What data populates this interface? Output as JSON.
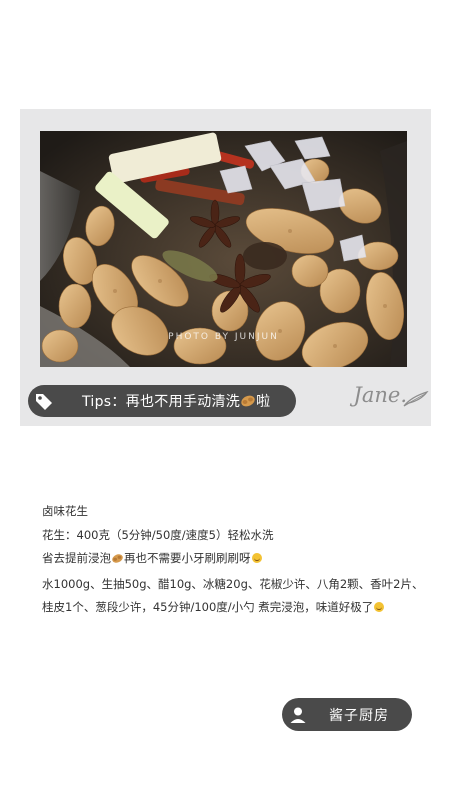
{
  "card": {
    "photo": {
      "alt": "Peanuts with star anise, cinnamon, chili, scallion and rock sugar in a pot",
      "watermark": "PHOTO BY JUNJUN"
    },
    "tips": {
      "icon": "tag-icon",
      "text_before": "Tips：再也不用手动清洗",
      "emoji": "peanut-emoji",
      "text_after": "啦"
    },
    "signature": "Jane.",
    "signature_icon": "feather-icon"
  },
  "recipe": {
    "title": "卤味花生",
    "line1": "花生：400克（5分钟/50度/速度5）轻松水洗",
    "line2_before": "省去提前浸泡",
    "line2_after": "再也不需要小牙刷刷刷呀",
    "line3": "水1000g、生抽50g、醋10g、冰糖20g、花椒少许、八角2颗、香叶2片、",
    "line4": "桂皮1个、葱段少许，45分钟/100度/小勺 煮完浸泡，味道好极了"
  },
  "author": {
    "icon": "user-icon",
    "name": "酱子厨房"
  },
  "colors": {
    "pill_bg": "#4a4a4a",
    "card_bg": "#e7e7e8",
    "text": "#333333",
    "signature": "#8d8d8d"
  }
}
